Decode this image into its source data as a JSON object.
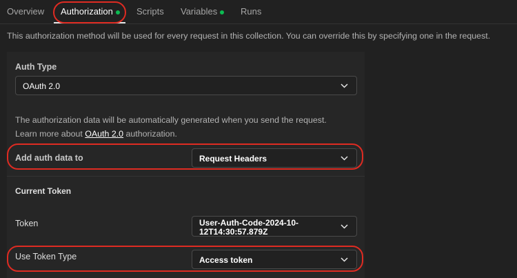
{
  "tabs": [
    {
      "label": "Overview",
      "active": false,
      "dot": false
    },
    {
      "label": "Authorization",
      "active": true,
      "dot": true
    },
    {
      "label": "Scripts",
      "active": false,
      "dot": false
    },
    {
      "label": "Variables",
      "active": false,
      "dot": true
    },
    {
      "label": "Runs",
      "active": false,
      "dot": false
    }
  ],
  "description": "This authorization method will be used for every request in this collection. You can override this by specifying one in the request.",
  "auth_type": {
    "label": "Auth Type",
    "value": "OAuth 2.0"
  },
  "info": {
    "line1": "The authorization data will be automatically generated when you send the request.",
    "line2_prefix": "Learn more about ",
    "line2_link": "OAuth 2.0",
    "line2_suffix": " authorization."
  },
  "add_auth_data": {
    "label": "Add auth data to",
    "value": "Request Headers"
  },
  "current_token": {
    "heading": "Current Token"
  },
  "token": {
    "label": "Token",
    "value_line1": "User-Auth-Code-2024-10-",
    "value_line2": "12T14:30:57.879Z"
  },
  "token_type": {
    "label": "Use Token Type",
    "value": "Access token"
  },
  "colors": {
    "accent_dot": "#0cbb52",
    "highlight": "#e02b22",
    "background": "#212121"
  }
}
